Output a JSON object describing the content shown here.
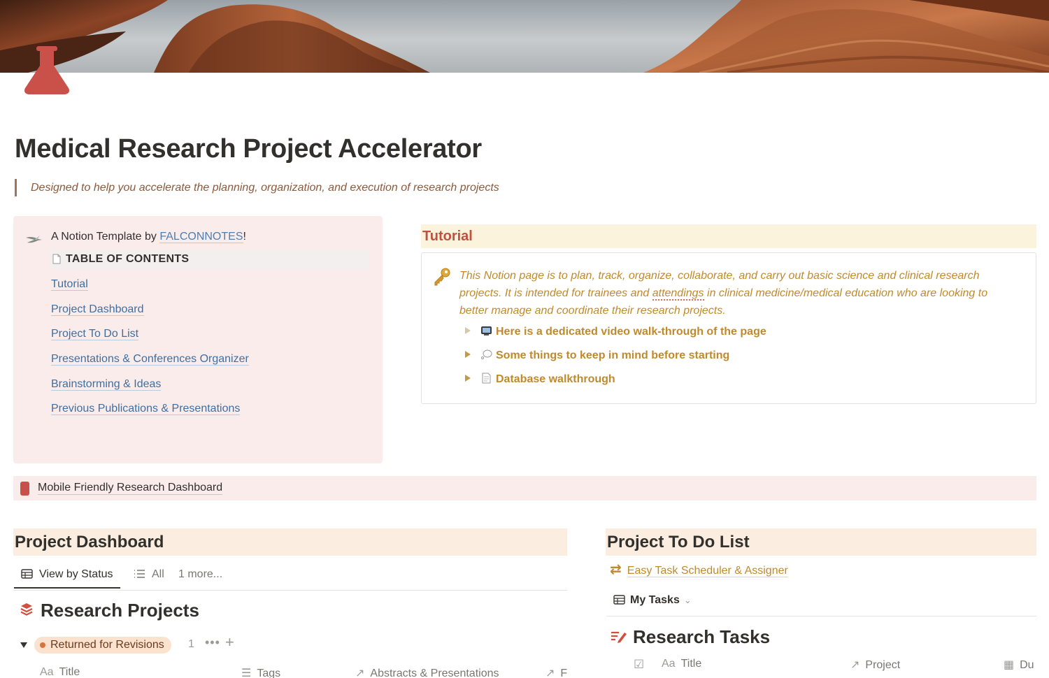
{
  "page": {
    "title": "Medical Research Project Accelerator",
    "subtitle": "Designed to help you accelerate the planning, organization, and execution of research projects"
  },
  "toc_callout": {
    "by_prefix": "A Notion Template by ",
    "brand": "FALCONNOTES",
    "by_suffix": "!",
    "heading": "TABLE OF CONTENTS",
    "items": [
      {
        "label": "Tutorial"
      },
      {
        "label": "Project Dashboard"
      },
      {
        "label": "Project To Do List"
      },
      {
        "label": "Presentations & Conferences Organizer"
      },
      {
        "label": "Brainstorming & Ideas"
      },
      {
        "label": "Previous Publications & Presentations"
      }
    ]
  },
  "tutorial": {
    "heading": "Tutorial",
    "text_a": "This Notion page is to plan, track, organize, collaborate, and carry out basic science and clinical research projects. It is intended for trainees and ",
    "text_spell": "attendings",
    "text_b": " in clinical medicine/medical education who are looking to better manage and coordinate their research projects.",
    "toggles": [
      {
        "label": "Here is a dedicated video walk-through of the page",
        "icon": "tv-icon"
      },
      {
        "label": "Some things to keep in mind before starting",
        "icon": "thought-bubble-icon"
      },
      {
        "label": "Database walkthrough",
        "icon": "document-icon"
      }
    ]
  },
  "mobile": {
    "label": "Mobile Friendly Research Dashboard"
  },
  "dashboard": {
    "heading": "Project Dashboard",
    "views": {
      "active": "View by Status",
      "all": "All",
      "more": "1 more..."
    },
    "db_title": "Research Projects",
    "group": {
      "label": "Returned for Revisions",
      "count": "1"
    },
    "columns": {
      "title_prefix": "Aa",
      "title": "Title",
      "tags": "Tags",
      "abstracts": "Abstracts & Presentations",
      "cut": "F"
    }
  },
  "todo": {
    "heading": "Project To Do List",
    "scheduler": "Easy Task Scheduler & Assigner",
    "view": "My Tasks",
    "db_title": "Research Tasks",
    "columns": {
      "title_prefix": "Aa",
      "title": "Title",
      "project": "Project",
      "due": "Du"
    }
  },
  "colors": {
    "accent_red": "#c0513f",
    "accent_gold": "#c08a2c",
    "link_blue": "#3d6fa1",
    "callout_pink": "#fbecec",
    "heading_peach": "#fbeee0",
    "heading_yellow": "#fbf3db"
  }
}
